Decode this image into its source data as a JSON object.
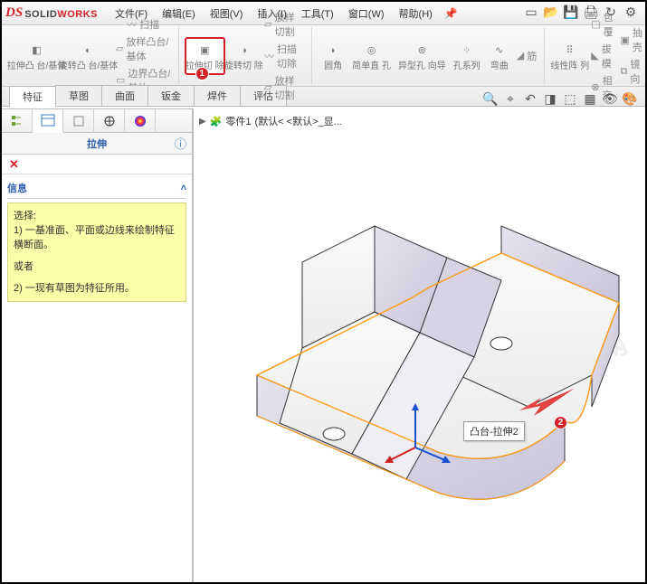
{
  "app": {
    "logo_prefix": "DS",
    "logo_a": "SOLID",
    "logo_b": "WORKS"
  },
  "menu": [
    "文件(F)",
    "编辑(E)",
    "视图(V)",
    "插入(I)",
    "工具(T)",
    "窗口(W)",
    "帮助(H)"
  ],
  "qat_icons": [
    "new",
    "open",
    "save",
    "print",
    "rebuild",
    "options"
  ],
  "ribbon": {
    "g1": [
      {
        "l": "拉伸凸\n台/基体"
      },
      {
        "l": "旋转凸\n台/基体"
      }
    ],
    "g1sub": [
      "扫描",
      "放样凸台/基体",
      "边界凸台/基体"
    ],
    "g2": [
      {
        "l": "拉伸切\n除",
        "hl": true,
        "badge": "1"
      },
      {
        "l": "旋转切\n除"
      }
    ],
    "g2sub": [
      "放样切割",
      "扫描切除",
      "放样切割"
    ],
    "g3": [
      {
        "l": "圆角"
      },
      {
        "l": "简单直\n孔"
      },
      {
        "l": "异型孔\n向导"
      },
      {
        "l": "孔系列"
      },
      {
        "l": "弯曲"
      }
    ],
    "g3top": "筋",
    "g4": [
      {
        "l": "线性阵\n列"
      }
    ],
    "g4sub": [
      "包覆",
      "拔模",
      "相交",
      "抽壳",
      "镜向"
    ]
  },
  "tabs": [
    "特征",
    "草图",
    "曲面",
    "钣金",
    "焊件",
    "评估"
  ],
  "activeTab": 0,
  "viewtools": [
    "zoom",
    "zoom-area",
    "prev",
    "section",
    "view-orient",
    "display-style",
    "hide-show",
    "appearance"
  ],
  "left": {
    "tabs": [
      "feature-tree",
      "property",
      "config",
      "dim",
      "appearance"
    ],
    "title": "拉伸",
    "section": "信息",
    "info_l1": "选择:",
    "info_l2": "1) 一基准面、平面或边线来绘制特征横断面。",
    "info_or": "或者",
    "info_l3": "2) 一现有草图为特征所用。"
  },
  "crumb": {
    "part": "零件1",
    "state": "(默认< <默认>_显..."
  },
  "tooltip": "凸台-拉伸2",
  "badge2": "2",
  "watermark": "软件自学网"
}
